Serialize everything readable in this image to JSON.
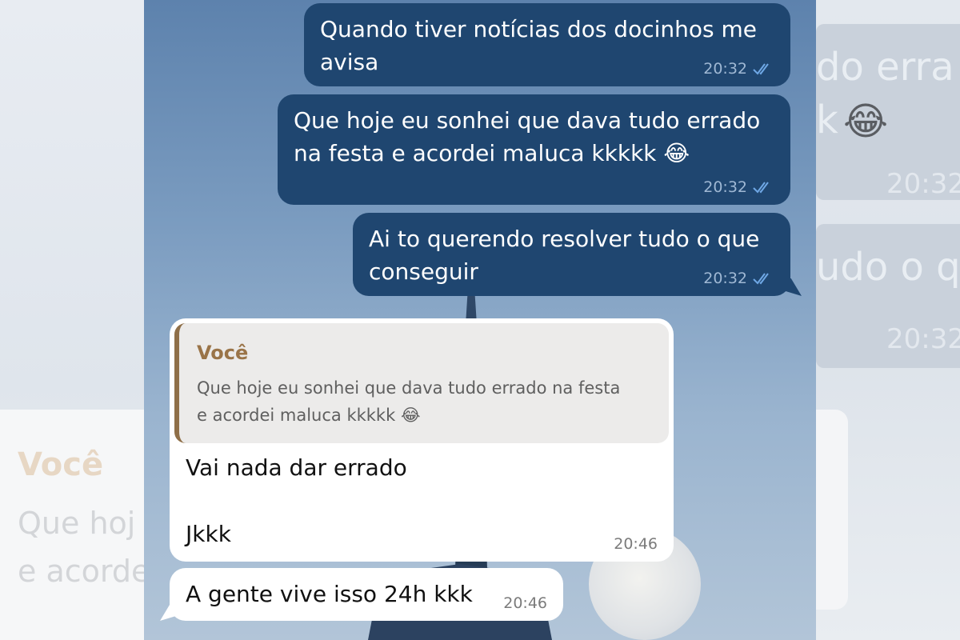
{
  "background": {
    "left_card_title": "Você",
    "left_card_lines": [
      "Que hoj",
      "e acorde"
    ],
    "right_fragments": [
      "do erra",
      "k",
      "udo o q"
    ],
    "right_times": [
      "20:32",
      "20:32"
    ]
  },
  "messages": [
    {
      "direction": "outgoing",
      "lines": [
        "Quando tiver notícias dos docinhos me",
        "avisa"
      ],
      "time": "20:32",
      "read": true
    },
    {
      "direction": "outgoing",
      "lines": [
        "Que hoje eu sonhei que dava tudo errado",
        "na festa e acordei maluca kkkkk"
      ],
      "emoji": "😂",
      "time": "20:32",
      "read": true
    },
    {
      "direction": "outgoing",
      "lines": [
        "Ai to querendo resolver tudo o que",
        "conseguir"
      ],
      "time": "20:32",
      "read": true
    },
    {
      "direction": "incoming",
      "reply_to": {
        "author": "Você",
        "lines": [
          "Que hoje eu sonhei que dava tudo errado na festa",
          "e acordei maluca kkkkk"
        ],
        "emoji": "😂"
      },
      "line1": "Vai nada dar errado",
      "line2": "Jkkk",
      "time": "20:46"
    },
    {
      "direction": "incoming",
      "text": "A gente vive isso 24h kkk",
      "time": "20:46"
    }
  ],
  "colors": {
    "outgoing_bubble": "#1f4670",
    "incoming_bubble": "#ffffff",
    "reply_author": "#9a7448",
    "read_ticks": "#6fa8e6"
  },
  "icons": {
    "read_receipt": "double-check-icon"
  }
}
